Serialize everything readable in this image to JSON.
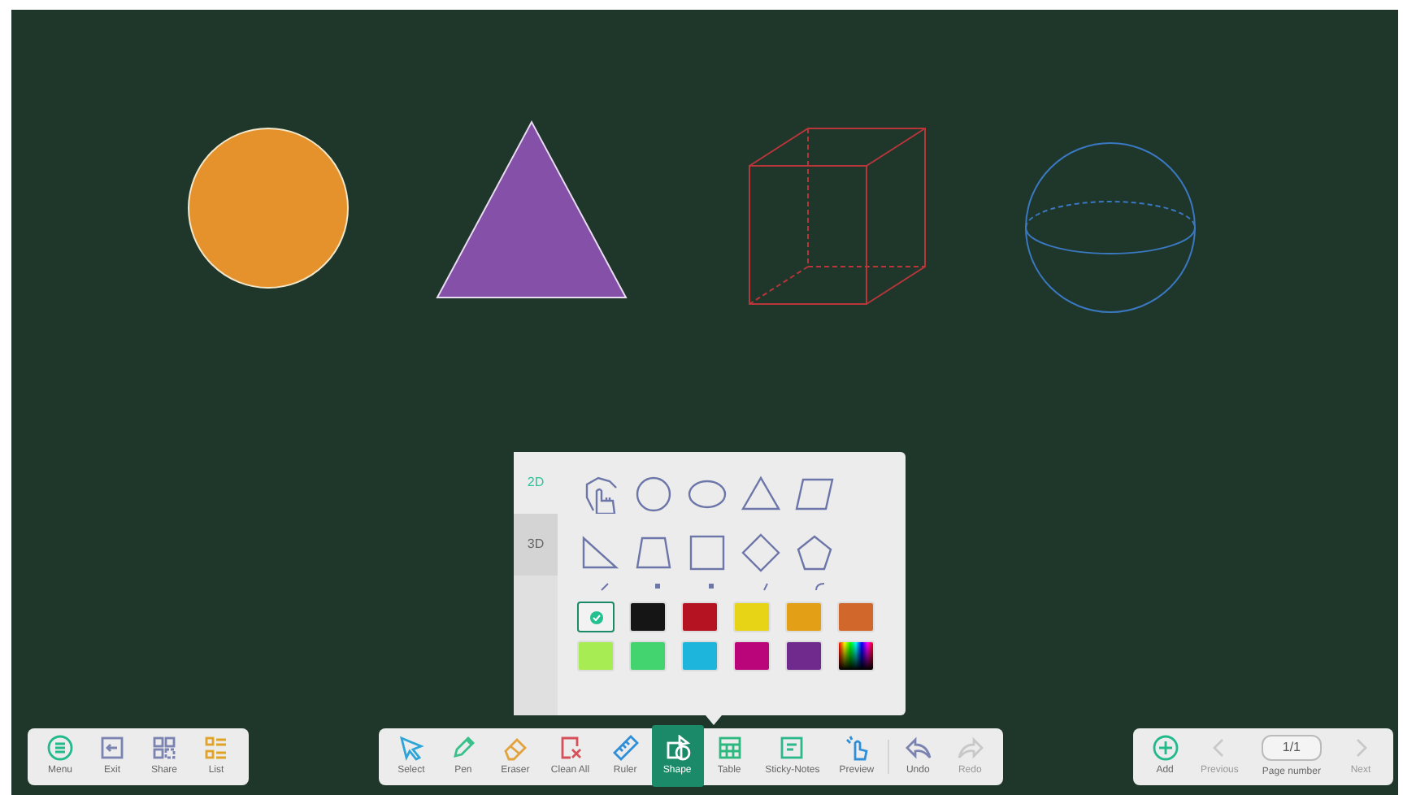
{
  "canvas_shapes": [
    {
      "kind": "circle",
      "color": "#e5922c"
    },
    {
      "kind": "triangle",
      "color": "#8550a8"
    },
    {
      "kind": "cube",
      "color": "#b8363a"
    },
    {
      "kind": "sphere",
      "color": "#3a78c0"
    }
  ],
  "shape_panel": {
    "tabs": [
      {
        "label": "2D",
        "selected": true
      },
      {
        "label": "3D",
        "selected": false
      }
    ],
    "shapes": [
      {
        "kind": "hand"
      },
      {
        "kind": "circle"
      },
      {
        "kind": "ellipse"
      },
      {
        "kind": "triangle"
      },
      {
        "kind": "parallelogram"
      },
      {
        "kind": "right-triangle"
      },
      {
        "kind": "trapezoid"
      },
      {
        "kind": "square"
      },
      {
        "kind": "diamond"
      },
      {
        "kind": "pentagon"
      }
    ],
    "colors": [
      {
        "color": "#f2f2f2",
        "selected": true
      },
      {
        "color": "#151515",
        "selected": false
      },
      {
        "color": "#b51222",
        "selected": false
      },
      {
        "color": "#e8d416",
        "selected": false
      },
      {
        "color": "#e39f15",
        "selected": false
      },
      {
        "color": "#d1672a",
        "selected": false
      },
      {
        "color": "#a6ec52",
        "selected": false
      },
      {
        "color": "#43d36f",
        "selected": false
      },
      {
        "color": "#1eb5dc",
        "selected": false
      },
      {
        "color": "#b9047a",
        "selected": false
      },
      {
        "color": "#702a8e",
        "selected": false
      },
      {
        "kind": "spectrum",
        "selected": false
      }
    ]
  },
  "left_toolbar": [
    {
      "label": "Menu",
      "kind": "menu"
    },
    {
      "label": "Exit",
      "kind": "exit"
    },
    {
      "label": "Share",
      "kind": "share"
    },
    {
      "label": "List",
      "kind": "list"
    }
  ],
  "main_toolbar": [
    {
      "label": "Select",
      "kind": "select",
      "selected": false,
      "disabled": false
    },
    {
      "label": "Pen",
      "kind": "pen",
      "selected": false,
      "disabled": false
    },
    {
      "label": "Eraser",
      "kind": "eraser",
      "selected": false,
      "disabled": false
    },
    {
      "label": "Clean All",
      "kind": "clean",
      "selected": false,
      "disabled": false
    },
    {
      "label": "Ruler",
      "kind": "ruler",
      "selected": false,
      "disabled": false
    },
    {
      "label": "Shape",
      "kind": "shape",
      "selected": true,
      "disabled": false
    },
    {
      "label": "Table",
      "kind": "table",
      "selected": false,
      "disabled": false
    },
    {
      "label": "Sticky-Notes",
      "kind": "notes",
      "selected": false,
      "disabled": false
    },
    {
      "label": "Preview",
      "kind": "preview",
      "selected": false,
      "disabled": false
    },
    {
      "label": "Undo",
      "kind": "undo",
      "selected": false,
      "disabled": false
    },
    {
      "label": "Redo",
      "kind": "redo",
      "selected": false,
      "disabled": true
    }
  ],
  "page_toolbar": {
    "add": {
      "label": "Add"
    },
    "previous": {
      "label": "Previous",
      "disabled": true
    },
    "page_number": {
      "value": "1/1",
      "label": "Page number"
    },
    "next": {
      "label": "Next",
      "disabled": true
    }
  }
}
